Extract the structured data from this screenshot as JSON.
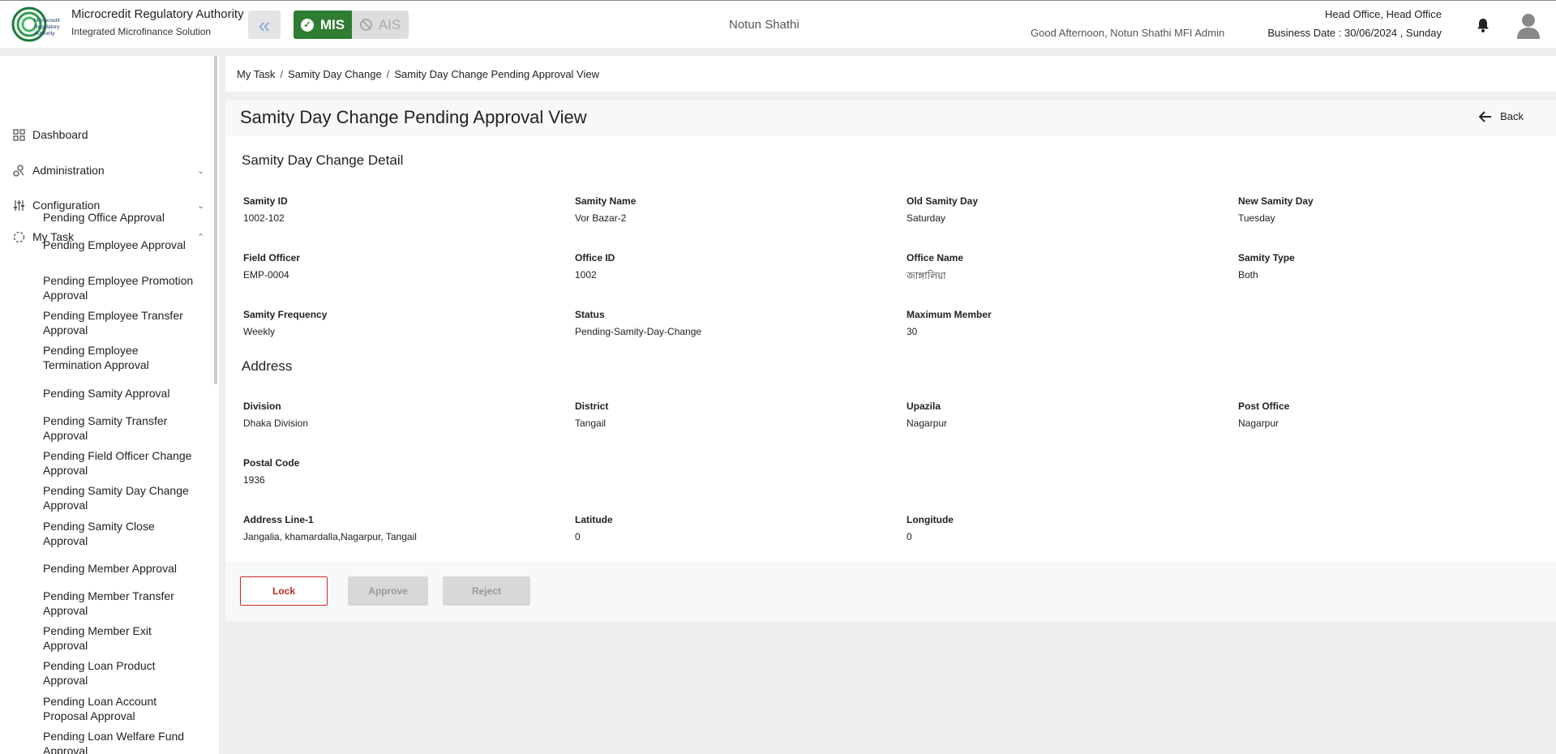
{
  "header": {
    "org_name": "Microcredit Regulatory Authority",
    "org_subtitle": "Integrated Microfinance Solution",
    "logo_text": "Microcredit Regulatory Authority",
    "mis_label": "MIS",
    "ais_label": "AIS",
    "center_title": "Notun Shathi",
    "greeting": "Good Afternoon, Notun Shathi MFI Admin",
    "office": "Head Office, Head Office",
    "business_date": "Business Date : 30/06/2024 , Sunday"
  },
  "sidebar": {
    "nav": [
      {
        "label": "Dashboard",
        "icon": "grid-icon"
      },
      {
        "label": "Administration",
        "icon": "admin-icon"
      },
      {
        "label": "Configuration",
        "icon": "sliders-icon"
      },
      {
        "label": "My Task",
        "icon": "task-icon"
      }
    ],
    "my_task_items": [
      "Pending Office Approval",
      "Pending Employee Approval",
      "Pending Employee Promotion Approval",
      "Pending Employee Transfer Approval",
      "Pending Employee Termination Approval",
      "Pending Samity Approval",
      "Pending Samity Transfer Approval",
      "Pending Field Officer Change Approval",
      "Pending Samity Day Change Approval",
      "Pending Samity Close Approval",
      "Pending Member Approval",
      "Pending Member Transfer Approval",
      "Pending Member Exit Approval",
      "Pending Loan Product Approval",
      "Pending Loan Account Proposal Approval",
      "Pending Loan Welfare Fund Approval"
    ]
  },
  "breadcrumb": [
    "My Task",
    "Samity Day Change",
    "Samity Day Change Pending Approval View"
  ],
  "page": {
    "title": "Samity Day Change Pending Approval View",
    "back_label": "Back"
  },
  "detail": {
    "section_title": "Samity Day Change Detail",
    "fields": [
      {
        "label": "Samity ID",
        "value": "1002-102"
      },
      {
        "label": "Samity Name",
        "value": "Vor Bazar-2"
      },
      {
        "label": "Old Samity Day",
        "value": "Saturday"
      },
      {
        "label": "New Samity Day",
        "value": "Tuesday"
      },
      {
        "label": "Field Officer",
        "value": "EMP-0004"
      },
      {
        "label": "Office ID",
        "value": "1002"
      },
      {
        "label": "Office Name",
        "value": "জাঙ্গালিয়া"
      },
      {
        "label": "Samity Type",
        "value": "Both"
      },
      {
        "label": "Samity Frequency",
        "value": "Weekly"
      },
      {
        "label": "Status",
        "value": "Pending-Samity-Day-Change"
      },
      {
        "label": "Maximum Member",
        "value": "30"
      }
    ]
  },
  "address": {
    "section_title": "Address",
    "fields": [
      {
        "label": "Division",
        "value": "Dhaka Division"
      },
      {
        "label": "District",
        "value": "Tangail"
      },
      {
        "label": "Upazila",
        "value": "Nagarpur"
      },
      {
        "label": "Post Office",
        "value": "Nagarpur"
      },
      {
        "label": "Postal Code",
        "value": "1936"
      },
      {
        "label": "Address Line-1",
        "value": "Jangalia, khamardalla,Nagarpur, Tangail"
      },
      {
        "label": "Latitude",
        "value": "0"
      },
      {
        "label": "Longitude",
        "value": "0"
      }
    ]
  },
  "actions": {
    "lock": "Lock",
    "approve": "Approve",
    "reject": "Reject"
  },
  "colors": {
    "mis_green": "#2e7d32",
    "lock_red": "#c62828"
  }
}
